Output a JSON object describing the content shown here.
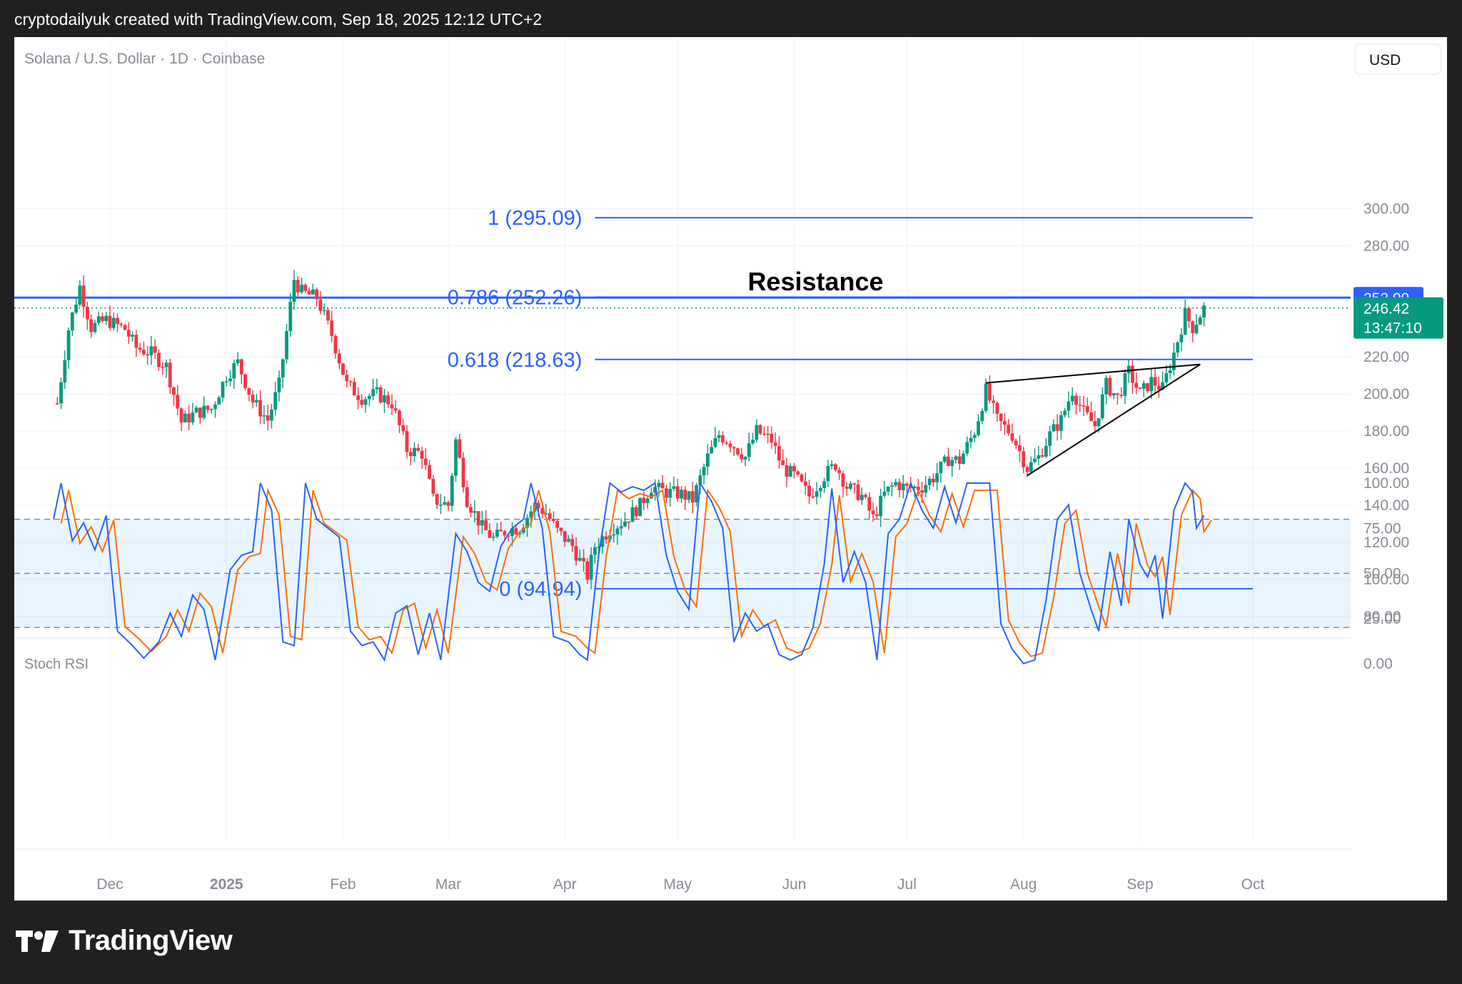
{
  "header": {
    "text": "cryptodailyuk created with TradingView.com, Sep 18, 2025 12:12 UTC+2"
  },
  "footer": {
    "logo_text": "TradingView"
  },
  "chart_data": {
    "type": "candlestick",
    "symbol_label": "Solana / U.S. Dollar · 1D · Coinbase",
    "currency_button": "USD",
    "price_axis": {
      "ticks": [
        "300.00",
        "280.00",
        "220.00",
        "200.00",
        "180.00",
        "160.00",
        "140.00",
        "120.00",
        "100.00",
        "80.00"
      ],
      "tick_values": [
        300,
        280,
        220,
        200,
        180,
        160,
        140,
        120,
        100,
        80
      ]
    },
    "time_axis": {
      "ticks": [
        "Dec",
        "2025",
        "Feb",
        "Mar",
        "Apr",
        "May",
        "Jun",
        "Jul",
        "Aug",
        "Sep",
        "Oct"
      ]
    },
    "fib_levels": [
      {
        "label": "1 (295.09)",
        "value": 295.09
      },
      {
        "label": "0.786 (252.26)",
        "value": 252.26
      },
      {
        "label": "0.618 (218.63)",
        "value": 218.63
      },
      {
        "label": "0 (94.94)",
        "value": 94.94
      }
    ],
    "resistance": {
      "label": "Resistance",
      "value": 252.0,
      "badge": "252.00"
    },
    "last_price": {
      "value": 246.42,
      "badge": "246.42",
      "countdown": "13:47:10"
    },
    "candle_path": [
      {
        "date": "2024-11-17",
        "price": 195
      },
      {
        "date": "2024-11-20",
        "price": 235
      },
      {
        "date": "2024-11-23",
        "price": 258
      },
      {
        "date": "2024-11-26",
        "price": 236
      },
      {
        "date": "2024-11-30",
        "price": 240
      },
      {
        "date": "2024-12-05",
        "price": 235
      },
      {
        "date": "2024-12-08",
        "price": 225
      },
      {
        "date": "2024-12-12",
        "price": 222
      },
      {
        "date": "2024-12-16",
        "price": 215
      },
      {
        "date": "2024-12-20",
        "price": 185
      },
      {
        "date": "2024-12-24",
        "price": 190
      },
      {
        "date": "2024-12-28",
        "price": 192
      },
      {
        "date": "2025-01-01",
        "price": 210
      },
      {
        "date": "2025-01-04",
        "price": 217
      },
      {
        "date": "2025-01-08",
        "price": 196
      },
      {
        "date": "2025-01-12",
        "price": 186
      },
      {
        "date": "2025-01-15",
        "price": 205
      },
      {
        "date": "2025-01-19",
        "price": 262
      },
      {
        "date": "2025-01-21",
        "price": 255
      },
      {
        "date": "2025-01-25",
        "price": 252
      },
      {
        "date": "2025-01-29",
        "price": 232
      },
      {
        "date": "2025-02-02",
        "price": 205
      },
      {
        "date": "2025-02-06",
        "price": 198
      },
      {
        "date": "2025-02-10",
        "price": 200
      },
      {
        "date": "2025-02-14",
        "price": 195
      },
      {
        "date": "2025-02-18",
        "price": 170
      },
      {
        "date": "2025-02-22",
        "price": 168
      },
      {
        "date": "2025-02-25",
        "price": 143
      },
      {
        "date": "2025-03-01",
        "price": 140
      },
      {
        "date": "2025-03-03",
        "price": 175
      },
      {
        "date": "2025-03-06",
        "price": 143
      },
      {
        "date": "2025-03-10",
        "price": 128
      },
      {
        "date": "2025-03-13",
        "price": 122
      },
      {
        "date": "2025-03-17",
        "price": 127
      },
      {
        "date": "2025-03-20",
        "price": 128
      },
      {
        "date": "2025-03-24",
        "price": 140
      },
      {
        "date": "2025-03-27",
        "price": 136
      },
      {
        "date": "2025-03-30",
        "price": 126
      },
      {
        "date": "2025-04-03",
        "price": 118
      },
      {
        "date": "2025-04-07",
        "price": 102
      },
      {
        "date": "2025-04-09",
        "price": 118
      },
      {
        "date": "2025-04-13",
        "price": 127
      },
      {
        "date": "2025-04-17",
        "price": 132
      },
      {
        "date": "2025-04-21",
        "price": 140
      },
      {
        "date": "2025-04-24",
        "price": 150
      },
      {
        "date": "2025-04-28",
        "price": 147
      },
      {
        "date": "2025-05-02",
        "price": 146
      },
      {
        "date": "2025-05-05",
        "price": 143
      },
      {
        "date": "2025-05-09",
        "price": 166
      },
      {
        "date": "2025-05-12",
        "price": 178
      },
      {
        "date": "2025-05-15",
        "price": 174
      },
      {
        "date": "2025-05-19",
        "price": 166
      },
      {
        "date": "2025-05-22",
        "price": 180
      },
      {
        "date": "2025-05-26",
        "price": 175
      },
      {
        "date": "2025-05-29",
        "price": 160
      },
      {
        "date": "2025-06-01",
        "price": 156
      },
      {
        "date": "2025-06-05",
        "price": 145
      },
      {
        "date": "2025-06-09",
        "price": 156
      },
      {
        "date": "2025-06-12",
        "price": 162
      },
      {
        "date": "2025-06-15",
        "price": 150
      },
      {
        "date": "2025-06-19",
        "price": 145
      },
      {
        "date": "2025-06-22",
        "price": 133
      },
      {
        "date": "2025-06-25",
        "price": 146
      },
      {
        "date": "2025-06-28",
        "price": 152
      },
      {
        "date": "2025-07-01",
        "price": 149
      },
      {
        "date": "2025-07-05",
        "price": 150
      },
      {
        "date": "2025-07-08",
        "price": 155
      },
      {
        "date": "2025-07-12",
        "price": 165
      },
      {
        "date": "2025-07-15",
        "price": 164
      },
      {
        "date": "2025-07-19",
        "price": 180
      },
      {
        "date": "2025-07-22",
        "price": 202
      },
      {
        "date": "2025-07-25",
        "price": 186
      },
      {
        "date": "2025-07-29",
        "price": 178
      },
      {
        "date": "2025-08-02",
        "price": 160
      },
      {
        "date": "2025-08-05",
        "price": 166
      },
      {
        "date": "2025-08-08",
        "price": 178
      },
      {
        "date": "2025-08-11",
        "price": 186
      },
      {
        "date": "2025-08-14",
        "price": 202
      },
      {
        "date": "2025-08-17",
        "price": 190
      },
      {
        "date": "2025-08-20",
        "price": 183
      },
      {
        "date": "2025-08-23",
        "price": 205
      },
      {
        "date": "2025-08-26",
        "price": 198
      },
      {
        "date": "2025-08-29",
        "price": 212
      },
      {
        "date": "2025-09-01",
        "price": 200
      },
      {
        "date": "2025-09-04",
        "price": 207
      },
      {
        "date": "2025-09-07",
        "price": 203
      },
      {
        "date": "2025-09-10",
        "price": 222
      },
      {
        "date": "2025-09-13",
        "price": 243
      },
      {
        "date": "2025-09-15",
        "price": 236
      },
      {
        "date": "2025-09-18",
        "price": 246.42
      }
    ],
    "trendlines": [
      {
        "name": "triangle-upper",
        "from": {
          "date": "2025-07-22",
          "price": 206
        },
        "to": {
          "date": "2025-09-17",
          "price": 216
        }
      },
      {
        "name": "triangle-lower",
        "from": {
          "date": "2025-08-02",
          "price": 156
        },
        "to": {
          "date": "2025-09-17",
          "price": 216
        }
      }
    ],
    "indicator": {
      "name": "Stoch RSI",
      "ticks": [
        "100.00",
        "75.00",
        "50.00",
        "25.00",
        "0.00"
      ],
      "tick_values": [
        100,
        75,
        50,
        25,
        0
      ],
      "bands": {
        "upper": 80,
        "middle": 50,
        "lower": 20
      },
      "k_color": "#2962ff",
      "d_color": "#ff6d00",
      "k": [
        {
          "date": "2024-11-16",
          "value": 80
        },
        {
          "date": "2024-11-18",
          "value": 100
        },
        {
          "date": "2024-11-21",
          "value": 68
        },
        {
          "date": "2024-11-24",
          "value": 78
        },
        {
          "date": "2024-11-27",
          "value": 63
        },
        {
          "date": "2024-11-30",
          "value": 82
        },
        {
          "date": "2024-12-03",
          "value": 18
        },
        {
          "date": "2024-12-07",
          "value": 10
        },
        {
          "date": "2024-12-10",
          "value": 3
        },
        {
          "date": "2024-12-14",
          "value": 12
        },
        {
          "date": "2024-12-17",
          "value": 28
        },
        {
          "date": "2024-12-20",
          "value": 15
        },
        {
          "date": "2024-12-23",
          "value": 38
        },
        {
          "date": "2024-12-26",
          "value": 30
        },
        {
          "date": "2024-12-29",
          "value": 2
        },
        {
          "date": "2025-01-02",
          "value": 52
        },
        {
          "date": "2025-01-05",
          "value": 60
        },
        {
          "date": "2025-01-08",
          "value": 62
        },
        {
          "date": "2025-01-10",
          "value": 100
        },
        {
          "date": "2025-01-13",
          "value": 85
        },
        {
          "date": "2025-01-16",
          "value": 12
        },
        {
          "date": "2025-01-19",
          "value": 10
        },
        {
          "date": "2025-01-22",
          "value": 100
        },
        {
          "date": "2025-01-25",
          "value": 80
        },
        {
          "date": "2025-01-28",
          "value": 75
        },
        {
          "date": "2025-01-31",
          "value": 70
        },
        {
          "date": "2025-02-03",
          "value": 18
        },
        {
          "date": "2025-02-06",
          "value": 10
        },
        {
          "date": "2025-02-09",
          "value": 12
        },
        {
          "date": "2025-02-12",
          "value": 2
        },
        {
          "date": "2025-02-15",
          "value": 28
        },
        {
          "date": "2025-02-18",
          "value": 32
        },
        {
          "date": "2025-02-21",
          "value": 5
        },
        {
          "date": "2025-02-24",
          "value": 28
        },
        {
          "date": "2025-02-27",
          "value": 2
        },
        {
          "date": "2025-03-03",
          "value": 72
        },
        {
          "date": "2025-03-06",
          "value": 62
        },
        {
          "date": "2025-03-09",
          "value": 45
        },
        {
          "date": "2025-03-12",
          "value": 40
        },
        {
          "date": "2025-03-15",
          "value": 65
        },
        {
          "date": "2025-03-18",
          "value": 75
        },
        {
          "date": "2025-03-21",
          "value": 80
        },
        {
          "date": "2025-03-23",
          "value": 100
        },
        {
          "date": "2025-03-26",
          "value": 75
        },
        {
          "date": "2025-03-29",
          "value": 15
        },
        {
          "date": "2025-04-02",
          "value": 12
        },
        {
          "date": "2025-04-05",
          "value": 5
        },
        {
          "date": "2025-04-07",
          "value": 2
        },
        {
          "date": "2025-04-10",
          "value": 60
        },
        {
          "date": "2025-04-13",
          "value": 100
        },
        {
          "date": "2025-04-16",
          "value": 95
        },
        {
          "date": "2025-04-19",
          "value": 98
        },
        {
          "date": "2025-04-22",
          "value": 96
        },
        {
          "date": "2025-04-25",
          "value": 100
        },
        {
          "date": "2025-04-28",
          "value": 60
        },
        {
          "date": "2025-05-01",
          "value": 40
        },
        {
          "date": "2025-05-04",
          "value": 30
        },
        {
          "date": "2025-05-07",
          "value": 100
        },
        {
          "date": "2025-05-10",
          "value": 90
        },
        {
          "date": "2025-05-13",
          "value": 75
        },
        {
          "date": "2025-05-16",
          "value": 12
        },
        {
          "date": "2025-05-19",
          "value": 28
        },
        {
          "date": "2025-05-22",
          "value": 18
        },
        {
          "date": "2025-05-25",
          "value": 22
        },
        {
          "date": "2025-05-28",
          "value": 5
        },
        {
          "date": "2025-05-31",
          "value": 2
        },
        {
          "date": "2025-06-03",
          "value": 5
        },
        {
          "date": "2025-06-06",
          "value": 20
        },
        {
          "date": "2025-06-09",
          "value": 55
        },
        {
          "date": "2025-06-11",
          "value": 97
        },
        {
          "date": "2025-06-14",
          "value": 45
        },
        {
          "date": "2025-06-17",
          "value": 62
        },
        {
          "date": "2025-06-20",
          "value": 45
        },
        {
          "date": "2025-06-23",
          "value": 2
        },
        {
          "date": "2025-06-26",
          "value": 72
        },
        {
          "date": "2025-06-29",
          "value": 80
        },
        {
          "date": "2025-07-02",
          "value": 100
        },
        {
          "date": "2025-07-05",
          "value": 85
        },
        {
          "date": "2025-07-08",
          "value": 75
        },
        {
          "date": "2025-07-11",
          "value": 98
        },
        {
          "date": "2025-07-14",
          "value": 78
        },
        {
          "date": "2025-07-17",
          "value": 100
        },
        {
          "date": "2025-07-20",
          "value": 100
        },
        {
          "date": "2025-07-23",
          "value": 100
        },
        {
          "date": "2025-07-26",
          "value": 22
        },
        {
          "date": "2025-07-29",
          "value": 8
        },
        {
          "date": "2025-08-01",
          "value": 0
        },
        {
          "date": "2025-08-04",
          "value": 2
        },
        {
          "date": "2025-08-07",
          "value": 35
        },
        {
          "date": "2025-08-10",
          "value": 80
        },
        {
          "date": "2025-08-13",
          "value": 88
        },
        {
          "date": "2025-08-16",
          "value": 50
        },
        {
          "date": "2025-08-19",
          "value": 30
        },
        {
          "date": "2025-08-21",
          "value": 18
        },
        {
          "date": "2025-08-24",
          "value": 62
        },
        {
          "date": "2025-08-27",
          "value": 32
        },
        {
          "date": "2025-08-29",
          "value": 80
        },
        {
          "date": "2025-09-01",
          "value": 55
        },
        {
          "date": "2025-09-03",
          "value": 48
        },
        {
          "date": "2025-09-05",
          "value": 60
        },
        {
          "date": "2025-09-07",
          "value": 25
        },
        {
          "date": "2025-09-10",
          "value": 85
        },
        {
          "date": "2025-09-13",
          "value": 100
        },
        {
          "date": "2025-09-15",
          "value": 95
        },
        {
          "date": "2025-09-16",
          "value": 75
        },
        {
          "date": "2025-09-18",
          "value": 82
        }
      ],
      "d_lag_days": 2
    }
  }
}
